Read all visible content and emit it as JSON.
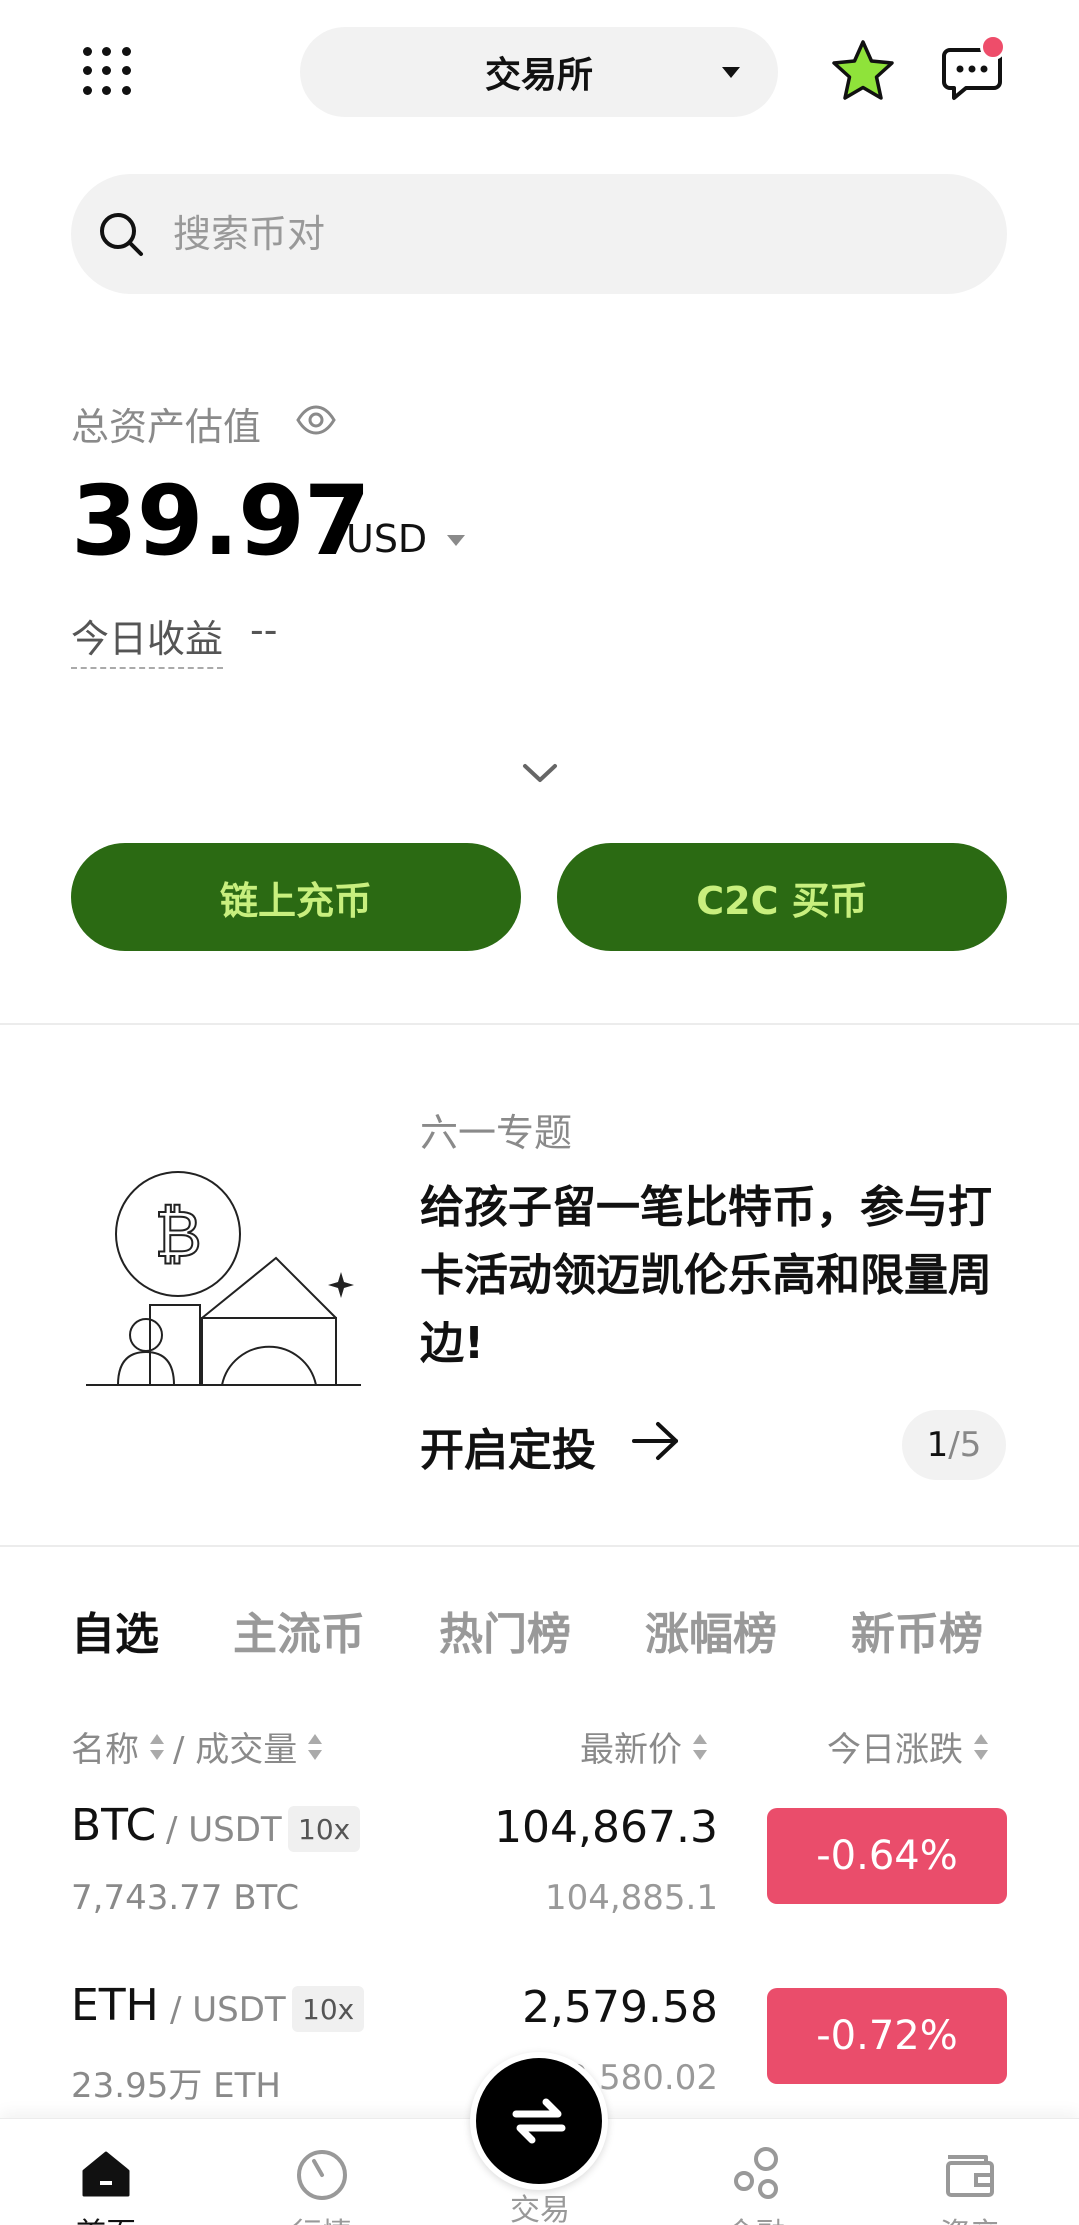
{
  "header": {
    "mode_selector": "交易所",
    "has_notification": true
  },
  "search": {
    "placeholder": "搜索币对"
  },
  "assets": {
    "label": "总资产估值",
    "balance": "39.97",
    "currency": "USD",
    "pnl_label": "今日收益",
    "pnl_value": "--"
  },
  "actions": {
    "deposit": "链上充币",
    "c2c": "C2C 买币"
  },
  "banner": {
    "tag": "六一专题",
    "text": "给孩子留一笔比特币，参与打卡活动领迈凯伦乐高和限量周边!",
    "cta": "开启定投",
    "pager_current": "1",
    "pager_total": "/5"
  },
  "market_tabs": [
    "自选",
    "主流币",
    "热门榜",
    "涨幅榜",
    "新币榜"
  ],
  "market_header": {
    "name": "名称",
    "volume": "/ 成交量",
    "price": "最新价",
    "change": "今日涨跌"
  },
  "market_rows": [
    {
      "base": "BTC",
      "quote": "/ USDT",
      "leverage": "10x",
      "volume": "7,743.77 BTC",
      "price": "104,867.3",
      "price_sub": "104,885.1",
      "change": "-0.64%"
    },
    {
      "base": "ETH",
      "quote": "/ USDT",
      "leverage": "10x",
      "volume": "23.95万 ETH",
      "price": "2,579.58",
      "price_sub": "2,580.02",
      "change": "-0.72%"
    }
  ],
  "bottom_nav": [
    "首页",
    "行情",
    "交易",
    "金融",
    "资产"
  ],
  "colors": {
    "accent_green": "#2b6a13",
    "accent_text": "#c8ef7e",
    "down_red": "#ea4d6b",
    "star": "#8fe33a"
  }
}
